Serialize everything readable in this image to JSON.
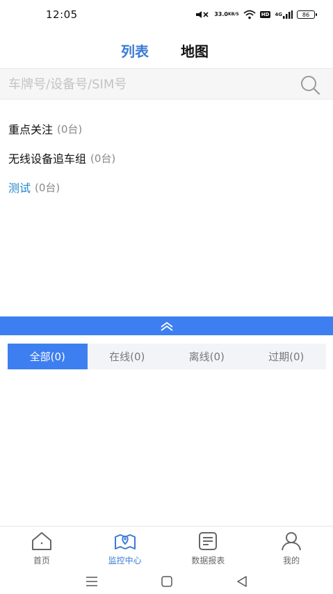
{
  "status_bar": {
    "time": "12:05",
    "net_speed_value": "33.0",
    "net_speed_unit": "KB/S",
    "hd_label": "HD",
    "signal_label": "4G",
    "battery": "86",
    "icons": [
      "mute-icon",
      "wifi-icon",
      "signal-icon",
      "battery-icon"
    ]
  },
  "header": {
    "tabs": [
      {
        "label": "列表",
        "active": true
      },
      {
        "label": "地图",
        "active": false
      }
    ]
  },
  "search": {
    "placeholder": "车牌号/设备号/SIM号",
    "value": ""
  },
  "groups": [
    {
      "name": "重点关注",
      "count": "(0台)",
      "active": false
    },
    {
      "name": "无线设备追车组",
      "count": "(0台)",
      "active": false
    },
    {
      "name": "测试",
      "count": "(0台)",
      "active": true
    }
  ],
  "filter_tabs": [
    {
      "label": "全部(0)",
      "active": true
    },
    {
      "label": "在线(0)",
      "active": false
    },
    {
      "label": "离线(0)",
      "active": false
    },
    {
      "label": "过期(0)",
      "active": false
    }
  ],
  "bottom_nav": [
    {
      "label": "首页",
      "icon": "home-icon",
      "active": false
    },
    {
      "label": "监控中心",
      "icon": "monitor-map-icon",
      "active": true
    },
    {
      "label": "数据报表",
      "icon": "report-icon",
      "active": false
    },
    {
      "label": "我的",
      "icon": "user-icon",
      "active": false
    }
  ],
  "colors": {
    "accent": "#3d7ff0",
    "header_active": "#3a7bd5",
    "group_active": "#1e88c8"
  }
}
